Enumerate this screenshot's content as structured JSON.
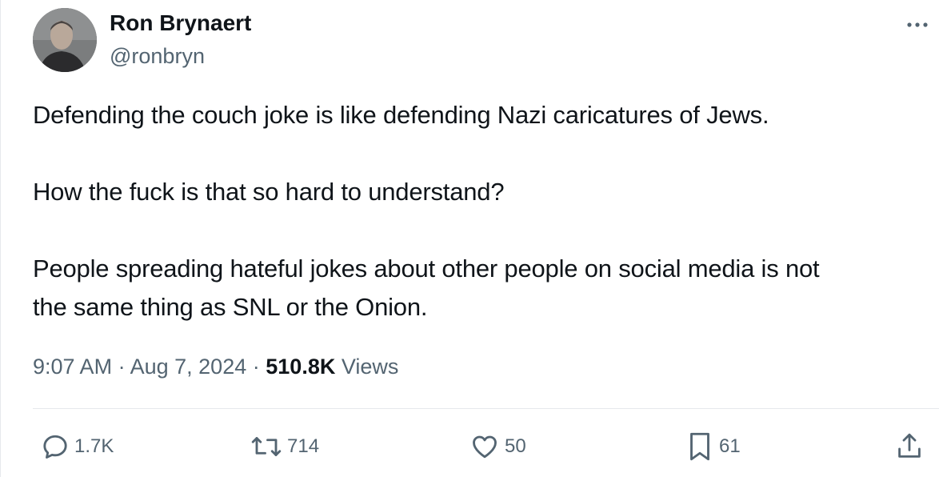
{
  "author": {
    "name": "Ron Brynaert",
    "handle": "@ronbryn"
  },
  "tweet": {
    "paragraphs": [
      "Defending the couch joke is like defending Nazi caricatures of Jews.",
      "How the fuck is that so hard to understand?",
      "People spreading hateful jokes about other people on social media is not",
      "the same thing as SNL or the Onion."
    ]
  },
  "meta": {
    "time": "9:07 AM",
    "separator": "·",
    "date": "Aug 7, 2024",
    "views_count": "510.8K",
    "views_label": "Views"
  },
  "actions": {
    "replies": "1.7K",
    "reposts": "714",
    "likes": "50",
    "bookmarks": "61"
  },
  "colors": {
    "text": "#0f1419",
    "secondary": "#536471",
    "divider": "#e6e9ec"
  },
  "icons": [
    "more-icon",
    "reply-icon",
    "retweet-icon",
    "heart-icon",
    "bookmark-icon",
    "share-icon"
  ]
}
